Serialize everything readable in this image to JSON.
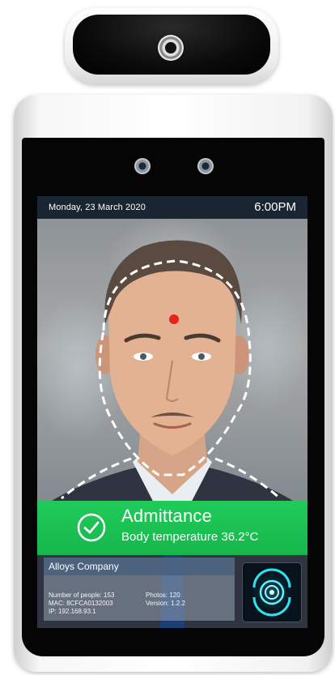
{
  "status_bar": {
    "date": "Monday, 23 March 2020",
    "time": "6:00PM"
  },
  "result": {
    "title": "Admittance",
    "temperature_text": "Body temperature 36.2°C",
    "color": "#1fcc59"
  },
  "info": {
    "company": "Alloys Company",
    "people": "Number of people: 153",
    "photos": "Photos: 120",
    "mac": "MAC: 8CFCA0132003",
    "version": "Version: 1.2.2",
    "ip": "IP: 192.168.93.1"
  },
  "icons": {
    "check": "check-circle-icon",
    "scan": "face-scan-icon",
    "temperature_point": "temperature-target-dot"
  }
}
